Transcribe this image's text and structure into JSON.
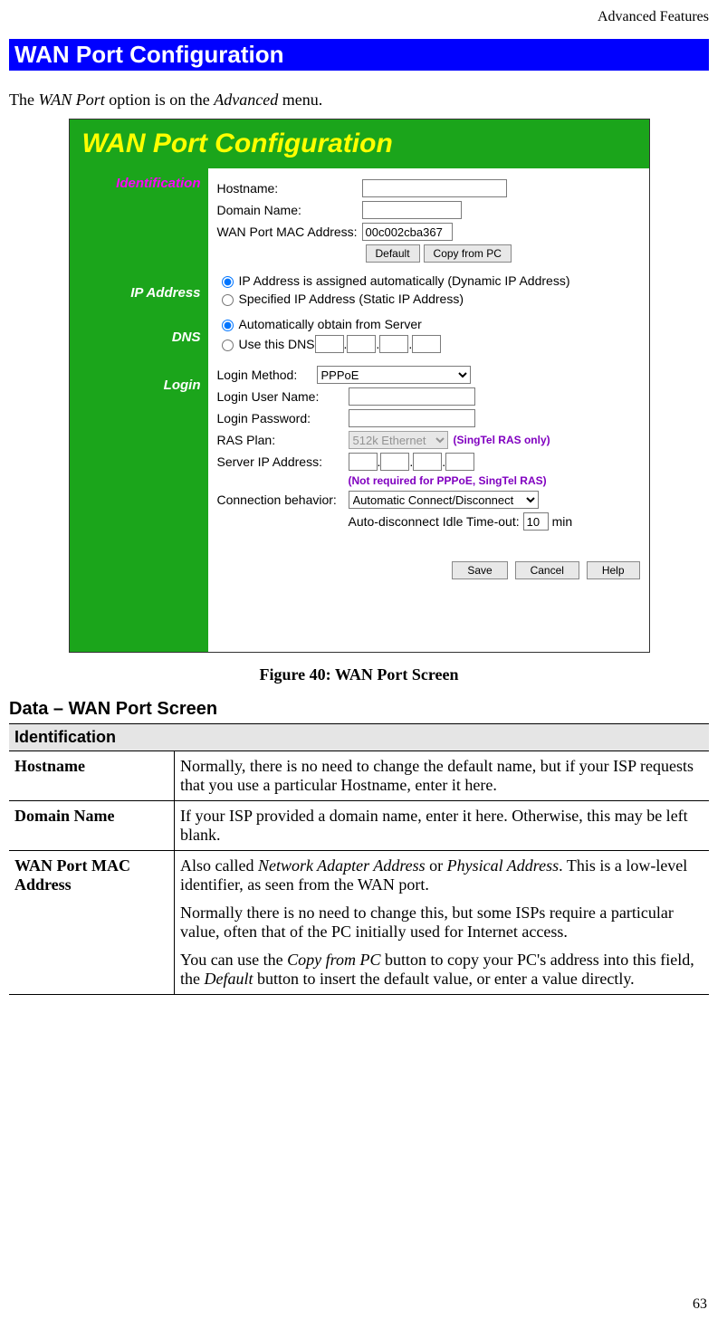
{
  "header": {
    "right": "Advanced Features"
  },
  "titleBar": "WAN Port Configuration",
  "intro": {
    "pre": "The ",
    "em1": "WAN Port",
    "mid": " option is on the ",
    "em2": "Advanced",
    "post": " menu."
  },
  "screenshot": {
    "title": "WAN Port Configuration",
    "sidebar": {
      "identification": "Identification",
      "ipaddress": "IP Address",
      "dns": "DNS",
      "login": "Login"
    },
    "identification": {
      "hostname_label": "Hostname:",
      "domain_label": "Domain Name:",
      "mac_label": "WAN Port MAC Address:",
      "mac_value": "00c002cba367",
      "default_btn": "Default",
      "copy_btn": "Copy from PC"
    },
    "ip": {
      "opt1": "IP Address is assigned automatically (Dynamic IP Address)",
      "opt2": "Specified IP Address (Static IP Address)"
    },
    "dns": {
      "opt1": "Automatically obtain from Server",
      "opt2_pre": "Use this DNS "
    },
    "login": {
      "method_label": "Login Method:",
      "method_value": "PPPoE",
      "user_label": "Login User Name:",
      "pass_label": "Login Password:",
      "ras_label": "RAS Plan:",
      "ras_value": "512k Ethernet",
      "ras_note": "(SingTel RAS only)",
      "server_label": "Server IP Address:",
      "server_note": "(Not required for PPPoE, SingTel RAS)",
      "conn_label": "Connection behavior:",
      "conn_value": "Automatic Connect/Disconnect",
      "idle_label": "Auto-disconnect Idle Time-out:",
      "idle_value": "10",
      "idle_unit": "min"
    },
    "bottom": {
      "save": "Save",
      "cancel": "Cancel",
      "help": "Help"
    }
  },
  "figure_caption": "Figure 40: WAN Port Screen",
  "subhead": "Data – WAN Port Screen",
  "table": {
    "category": "Identification",
    "rows": [
      {
        "key": "Hostname",
        "val": "Normally, there is no need to change the default name, but if your ISP requests that you use a particular Hostname, enter it here."
      },
      {
        "key": "Domain Name",
        "val": "If your ISP provided a domain name, enter it here. Otherwise, this may be left blank."
      },
      {
        "key": "WAN Port MAC Address",
        "p1a": "Also called ",
        "p1em1": "Network Adapter Address",
        "p1b": " or ",
        "p1em2": "Physical Address",
        "p1c": ". This is a low-level identifier, as seen from the WAN port.",
        "p2": "Normally there is no need to change this, but some ISPs require a particular value, often that of the PC initially used for Internet access.",
        "p3a": "You can use the ",
        "p3em1": "Copy from PC",
        "p3b": " button to copy your PC's address into this field, the ",
        "p3em2": "Default",
        "p3c": " button to insert the default value, or enter a value directly."
      }
    ]
  },
  "pagenum": "63"
}
